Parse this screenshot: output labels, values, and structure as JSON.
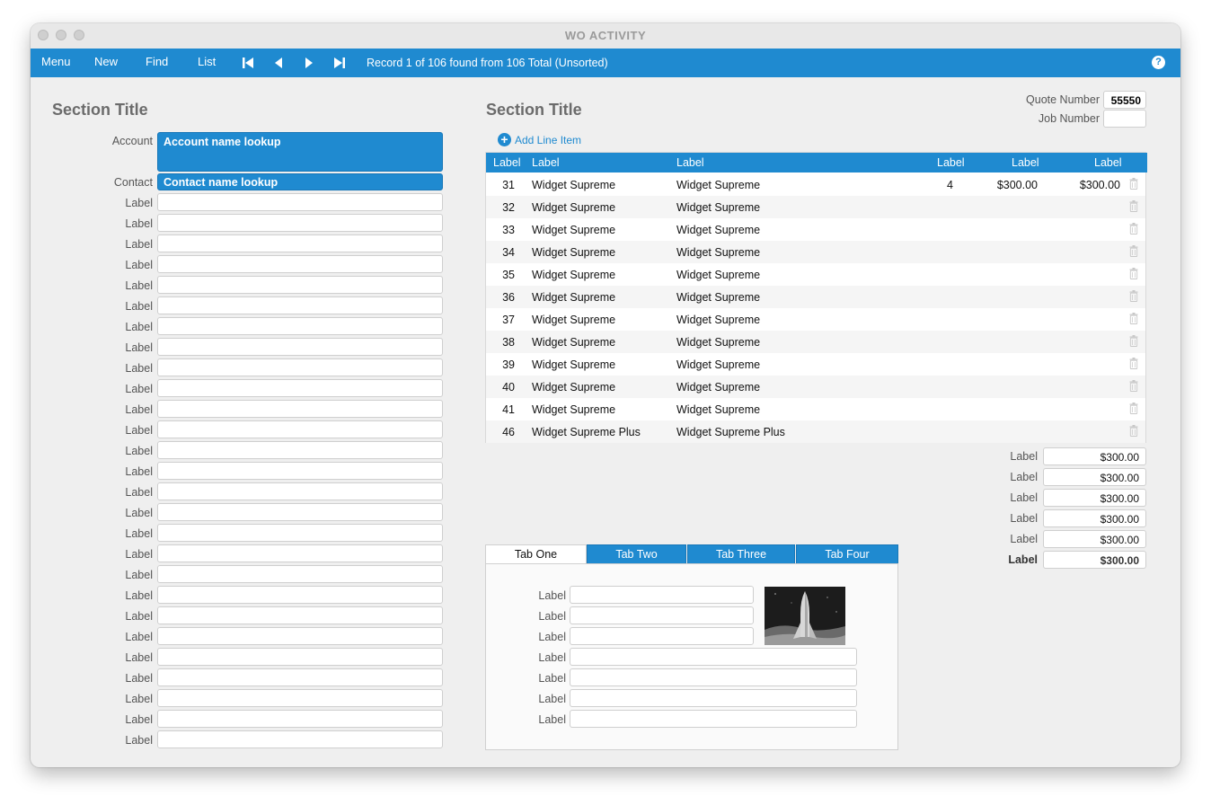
{
  "window": {
    "title": "WO ACTIVITY"
  },
  "toolbar": {
    "menu": "Menu",
    "new": "New",
    "find": "Find",
    "list": "List",
    "record_status": "Record 1 of 106 found from 106 Total (Unsorted)",
    "help": "?"
  },
  "left": {
    "section_title": "Section Title",
    "account_label": "Account",
    "account_value": "Account name lookup",
    "contact_label": "Contact",
    "contact_value": "Contact name lookup",
    "field_labels": [
      "Label",
      "Label",
      "Label",
      "Label",
      "Label",
      "Label",
      "Label",
      "Label",
      "Label",
      "Label",
      "Label",
      "Label",
      "Label",
      "Label",
      "Label",
      "Label",
      "Label",
      "Label",
      "Label",
      "Label",
      "Label",
      "Label",
      "Label",
      "Label",
      "Label",
      "Label",
      "Label"
    ]
  },
  "right": {
    "section_title": "Section Title",
    "quote_label": "Quote Number",
    "quote_value": "55550",
    "job_label": "Job Number",
    "job_value": "",
    "add_line_item": "Add Line Item",
    "table": {
      "headers": [
        "Label",
        "Label",
        "Label",
        "Label",
        "Label",
        "Label"
      ],
      "rows": [
        {
          "num": "31",
          "item": "Widget Supreme",
          "desc": "Widget Supreme",
          "qty": "4",
          "price": "$300.00",
          "total": "$300.00"
        },
        {
          "num": "32",
          "item": "Widget Supreme",
          "desc": "Widget Supreme",
          "qty": "",
          "price": "",
          "total": ""
        },
        {
          "num": "33",
          "item": "Widget Supreme",
          "desc": "Widget Supreme",
          "qty": "",
          "price": "",
          "total": ""
        },
        {
          "num": "34",
          "item": "Widget Supreme",
          "desc": "Widget Supreme",
          "qty": "",
          "price": "",
          "total": ""
        },
        {
          "num": "35",
          "item": "Widget Supreme",
          "desc": "Widget Supreme",
          "qty": "",
          "price": "",
          "total": ""
        },
        {
          "num": "36",
          "item": "Widget Supreme",
          "desc": "Widget Supreme",
          "qty": "",
          "price": "",
          "total": ""
        },
        {
          "num": "37",
          "item": "Widget Supreme",
          "desc": "Widget Supreme",
          "qty": "",
          "price": "",
          "total": ""
        },
        {
          "num": "38",
          "item": "Widget Supreme",
          "desc": "Widget Supreme",
          "qty": "",
          "price": "",
          "total": ""
        },
        {
          "num": "39",
          "item": "Widget Supreme",
          "desc": "Widget Supreme",
          "qty": "",
          "price": "",
          "total": ""
        },
        {
          "num": "40",
          "item": "Widget Supreme",
          "desc": "Widget Supreme",
          "qty": "",
          "price": "",
          "total": ""
        },
        {
          "num": "41",
          "item": "Widget Supreme",
          "desc": "Widget Supreme",
          "qty": "",
          "price": "",
          "total": ""
        },
        {
          "num": "46",
          "item": "Widget Supreme Plus",
          "desc": "Widget Supreme Plus",
          "qty": "",
          "price": "",
          "total": ""
        }
      ]
    },
    "totals": [
      {
        "label": "Label",
        "value": "$300.00"
      },
      {
        "label": "Label",
        "value": "$300.00"
      },
      {
        "label": "Label",
        "value": "$300.00"
      },
      {
        "label": "Label",
        "value": "$300.00"
      },
      {
        "label": "Label",
        "value": "$300.00"
      },
      {
        "label": "Label",
        "value": "$300.00"
      }
    ],
    "tabs": [
      "Tab One",
      "Tab Two",
      "Tab Three",
      "Tab Four"
    ],
    "tab_field_labels": [
      "Label",
      "Label",
      "Label",
      "Label",
      "Label",
      "Label",
      "Label"
    ]
  },
  "colors": {
    "accent": "#1f8ad0",
    "background": "#efefef"
  }
}
